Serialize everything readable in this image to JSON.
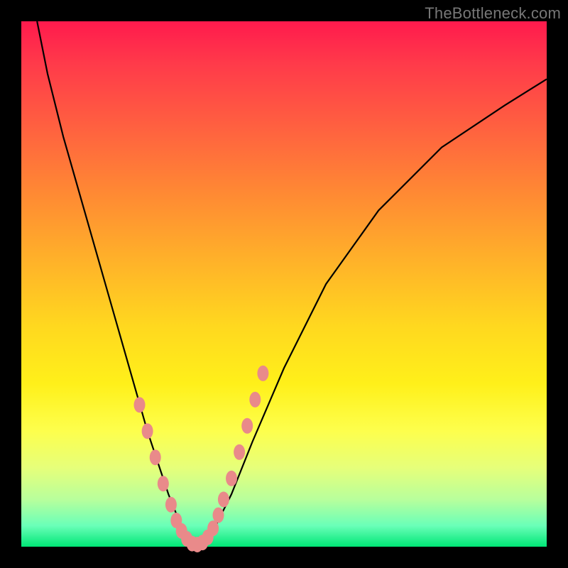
{
  "watermark": "TheBottleneck.com",
  "chart_data": {
    "type": "line",
    "title": "",
    "xlabel": "",
    "ylabel": "",
    "xlim": [
      0,
      100
    ],
    "ylim": [
      0,
      100
    ],
    "series": [
      {
        "name": "bottleneck-curve",
        "x": [
          3,
          5,
          8,
          12,
          16,
          20,
          24,
          26,
          28,
          30,
          31,
          32,
          33,
          34,
          35,
          37,
          40,
          44,
          50,
          58,
          68,
          80,
          92,
          100
        ],
        "y": [
          100,
          90,
          78,
          64,
          50,
          36,
          22,
          16,
          10,
          5,
          2,
          0.8,
          0.3,
          0.5,
          1.5,
          4,
          10,
          20,
          34,
          50,
          64,
          76,
          84,
          89
        ]
      }
    ],
    "markers": {
      "name": "highlight-dots",
      "color": "#e98a8a",
      "x": [
        22.5,
        24.0,
        25.5,
        27.0,
        28.5,
        29.5,
        30.5,
        31.5,
        32.5,
        33.5,
        34.5,
        35.5,
        36.5,
        37.5,
        38.5,
        40.0,
        41.5,
        43.0,
        44.5,
        46.0
      ],
      "y": [
        27,
        22,
        17,
        12,
        8,
        5,
        3,
        1.5,
        0.6,
        0.4,
        0.8,
        1.8,
        3.5,
        6,
        9,
        13,
        18,
        23,
        28,
        33
      ]
    }
  },
  "colors": {
    "curve": "#000000",
    "marker": "#e98a8a"
  }
}
